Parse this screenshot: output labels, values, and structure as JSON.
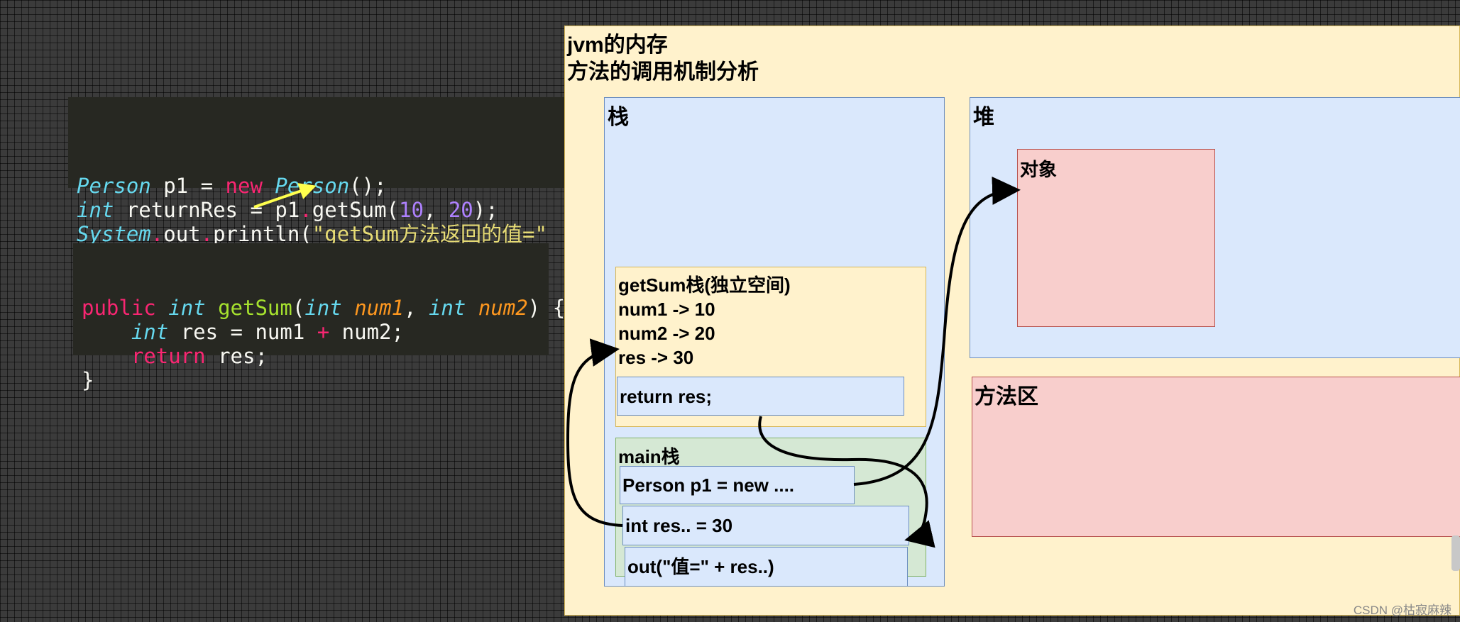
{
  "code_snippet_main": {
    "lines": [
      [
        {
          "t": "Person",
          "c": "ty"
        },
        {
          "t": " p1 = ",
          "c": ""
        },
        {
          "t": "new",
          "c": "kw"
        },
        {
          "t": " ",
          "c": ""
        },
        {
          "t": "Person",
          "c": "ty"
        },
        {
          "t": "();",
          "c": ""
        }
      ],
      [
        {
          "t": "int",
          "c": "ty"
        },
        {
          "t": " returnRes = p1",
          "c": ""
        },
        {
          "t": ".",
          "c": "kw"
        },
        {
          "t": "getSum(",
          "c": ""
        },
        {
          "t": "10",
          "c": "num"
        },
        {
          "t": ", ",
          "c": ""
        },
        {
          "t": "20",
          "c": "num"
        },
        {
          "t": ");",
          "c": ""
        }
      ],
      [
        {
          "t": "System",
          "c": "ty"
        },
        {
          "t": ".",
          "c": "kw"
        },
        {
          "t": "out",
          "c": ""
        },
        {
          "t": ".",
          "c": "kw"
        },
        {
          "t": "println(",
          "c": ""
        },
        {
          "t": "\"getSum方法返回的值=\"",
          "c": "str"
        }
      ]
    ]
  },
  "code_snippet_method": {
    "lines": [
      [
        {
          "t": "public",
          "c": "kw"
        },
        {
          "t": " ",
          "c": ""
        },
        {
          "t": "int",
          "c": "ty"
        },
        {
          "t": " ",
          "c": ""
        },
        {
          "t": "getSum",
          "c": "fn"
        },
        {
          "t": "(",
          "c": ""
        },
        {
          "t": "int",
          "c": "ty"
        },
        {
          "t": " ",
          "c": ""
        },
        {
          "t": "num1",
          "c": "par"
        },
        {
          "t": ", ",
          "c": ""
        },
        {
          "t": "int",
          "c": "ty"
        },
        {
          "t": " ",
          "c": ""
        },
        {
          "t": "num2",
          "c": "par"
        },
        {
          "t": ") {",
          "c": ""
        }
      ],
      [
        {
          "t": "    ",
          "c": ""
        },
        {
          "t": "int",
          "c": "ty"
        },
        {
          "t": " res = num1 ",
          "c": ""
        },
        {
          "t": "+",
          "c": "kw"
        },
        {
          "t": " num2;",
          "c": ""
        }
      ],
      [
        {
          "t": "    ",
          "c": ""
        },
        {
          "t": "return",
          "c": "kw"
        },
        {
          "t": " res;",
          "c": ""
        }
      ],
      [
        {
          "t": "}",
          "c": ""
        }
      ]
    ]
  },
  "diagram": {
    "title_line1": "jvm的内存",
    "title_line2": "方法的调用机制分析",
    "stack_label": "栈",
    "heap_label": "堆",
    "object_label": "对象",
    "method_area_label": "方法区",
    "getsum_frame": {
      "title": "getSum栈(独立空间)",
      "line1": "num1 -> 10",
      "line2": "num2 -> 20",
      "line3": "res -> 30",
      "return_stmt": "return res;"
    },
    "main_frame": {
      "title": "main栈",
      "stmt1": "Person p1 = new ....",
      "stmt2": "int res.. = 30",
      "stmt3": "out(\"值=\" + res..)"
    }
  },
  "colors": {
    "frame_yellow": "#fff2cc",
    "stack_blue": "#dae8fc",
    "main_green": "#d5e8d4",
    "object_red": "#f8cecc",
    "annotation_arrow": "#ffff4d"
  },
  "watermark": "CSDN @枯寂麻辣"
}
